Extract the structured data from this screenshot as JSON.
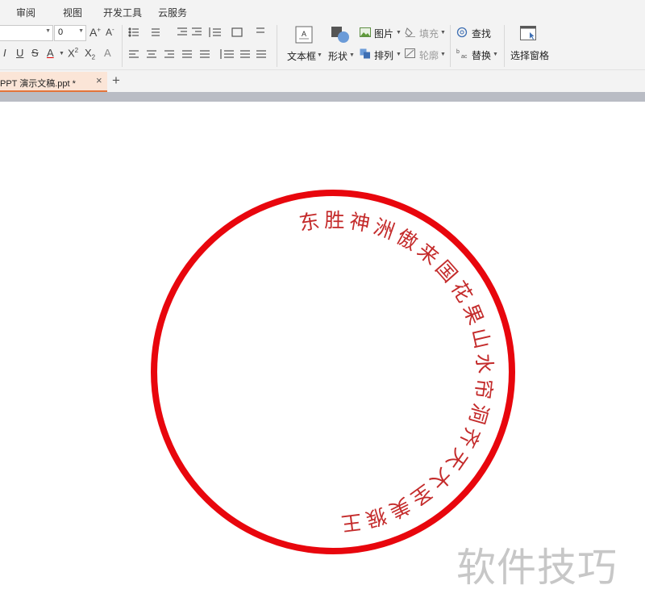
{
  "menu": {
    "tabs": [
      "审阅",
      "视图",
      "开发工具",
      "云服务"
    ]
  },
  "ribbon": {
    "font_size_value": "0",
    "textbox_label": "文本框",
    "shape_label": "形状",
    "picture_label": "图片",
    "fill_label": "填充",
    "arrange_label": "排列",
    "outline_label": "轮廓",
    "find_label": "查找",
    "replace_label": "替换",
    "select_pane_label": "选择窗格"
  },
  "doc_tabs": {
    "active_file": "PPT 演示文稿.ppt *",
    "close_glyph": "×",
    "new_tab_glyph": "+"
  },
  "slide": {
    "arc_text": "东胜神洲傲来国花果山水帘洞齐天大圣美猴王",
    "arc_start_deg": 261,
    "arc_end_deg": 443,
    "colors": {
      "ring": "#e8060d",
      "text": "#c42b2b"
    }
  },
  "watermark": "软件技巧"
}
